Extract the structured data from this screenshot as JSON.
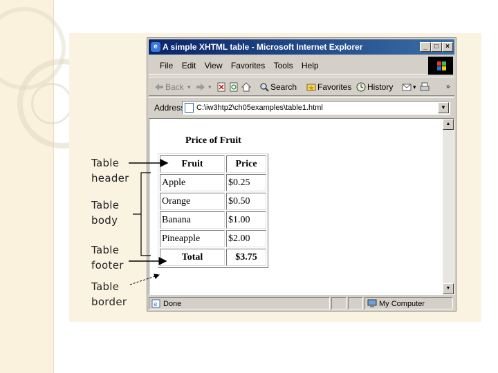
{
  "window": {
    "title": "A simple XHTML table - Microsoft Internet Explorer",
    "controls": {
      "minimize": "_",
      "maximize": "□",
      "close": "×"
    }
  },
  "menu": [
    "File",
    "Edit",
    "View",
    "Favorites",
    "Tools",
    "Help"
  ],
  "toolbar": {
    "back": "Back",
    "search": "Search",
    "favorites": "Favorites",
    "history": "History",
    "overflow": "»"
  },
  "address": {
    "label": "Address",
    "value": "C:\\iw3htp2\\ch05examples\\table1.html"
  },
  "page": {
    "caption": "Price of Fruit",
    "table": {
      "headers": [
        "Fruit",
        "Price"
      ],
      "rows": [
        [
          "Apple",
          "$0.25"
        ],
        [
          "Orange",
          "$0.50"
        ],
        [
          "Banana",
          "$1.00"
        ],
        [
          "Pineapple",
          "$2.00"
        ]
      ],
      "footer": [
        "Total",
        "$3.75"
      ]
    }
  },
  "status": {
    "text": "Done",
    "zone": "My Computer"
  },
  "annotations": {
    "header": [
      "Table",
      "header"
    ],
    "body": [
      "Table",
      "body"
    ],
    "footer": [
      "Table",
      "footer"
    ],
    "border": [
      "Table",
      "border"
    ]
  },
  "colors": {
    "title_bar_start": "#0a246a",
    "title_bar_end": "#3a6ea5",
    "window_chrome": "#d4d0c8",
    "panel_background": "#fbf3e2",
    "left_band": "#fbf2dd"
  }
}
